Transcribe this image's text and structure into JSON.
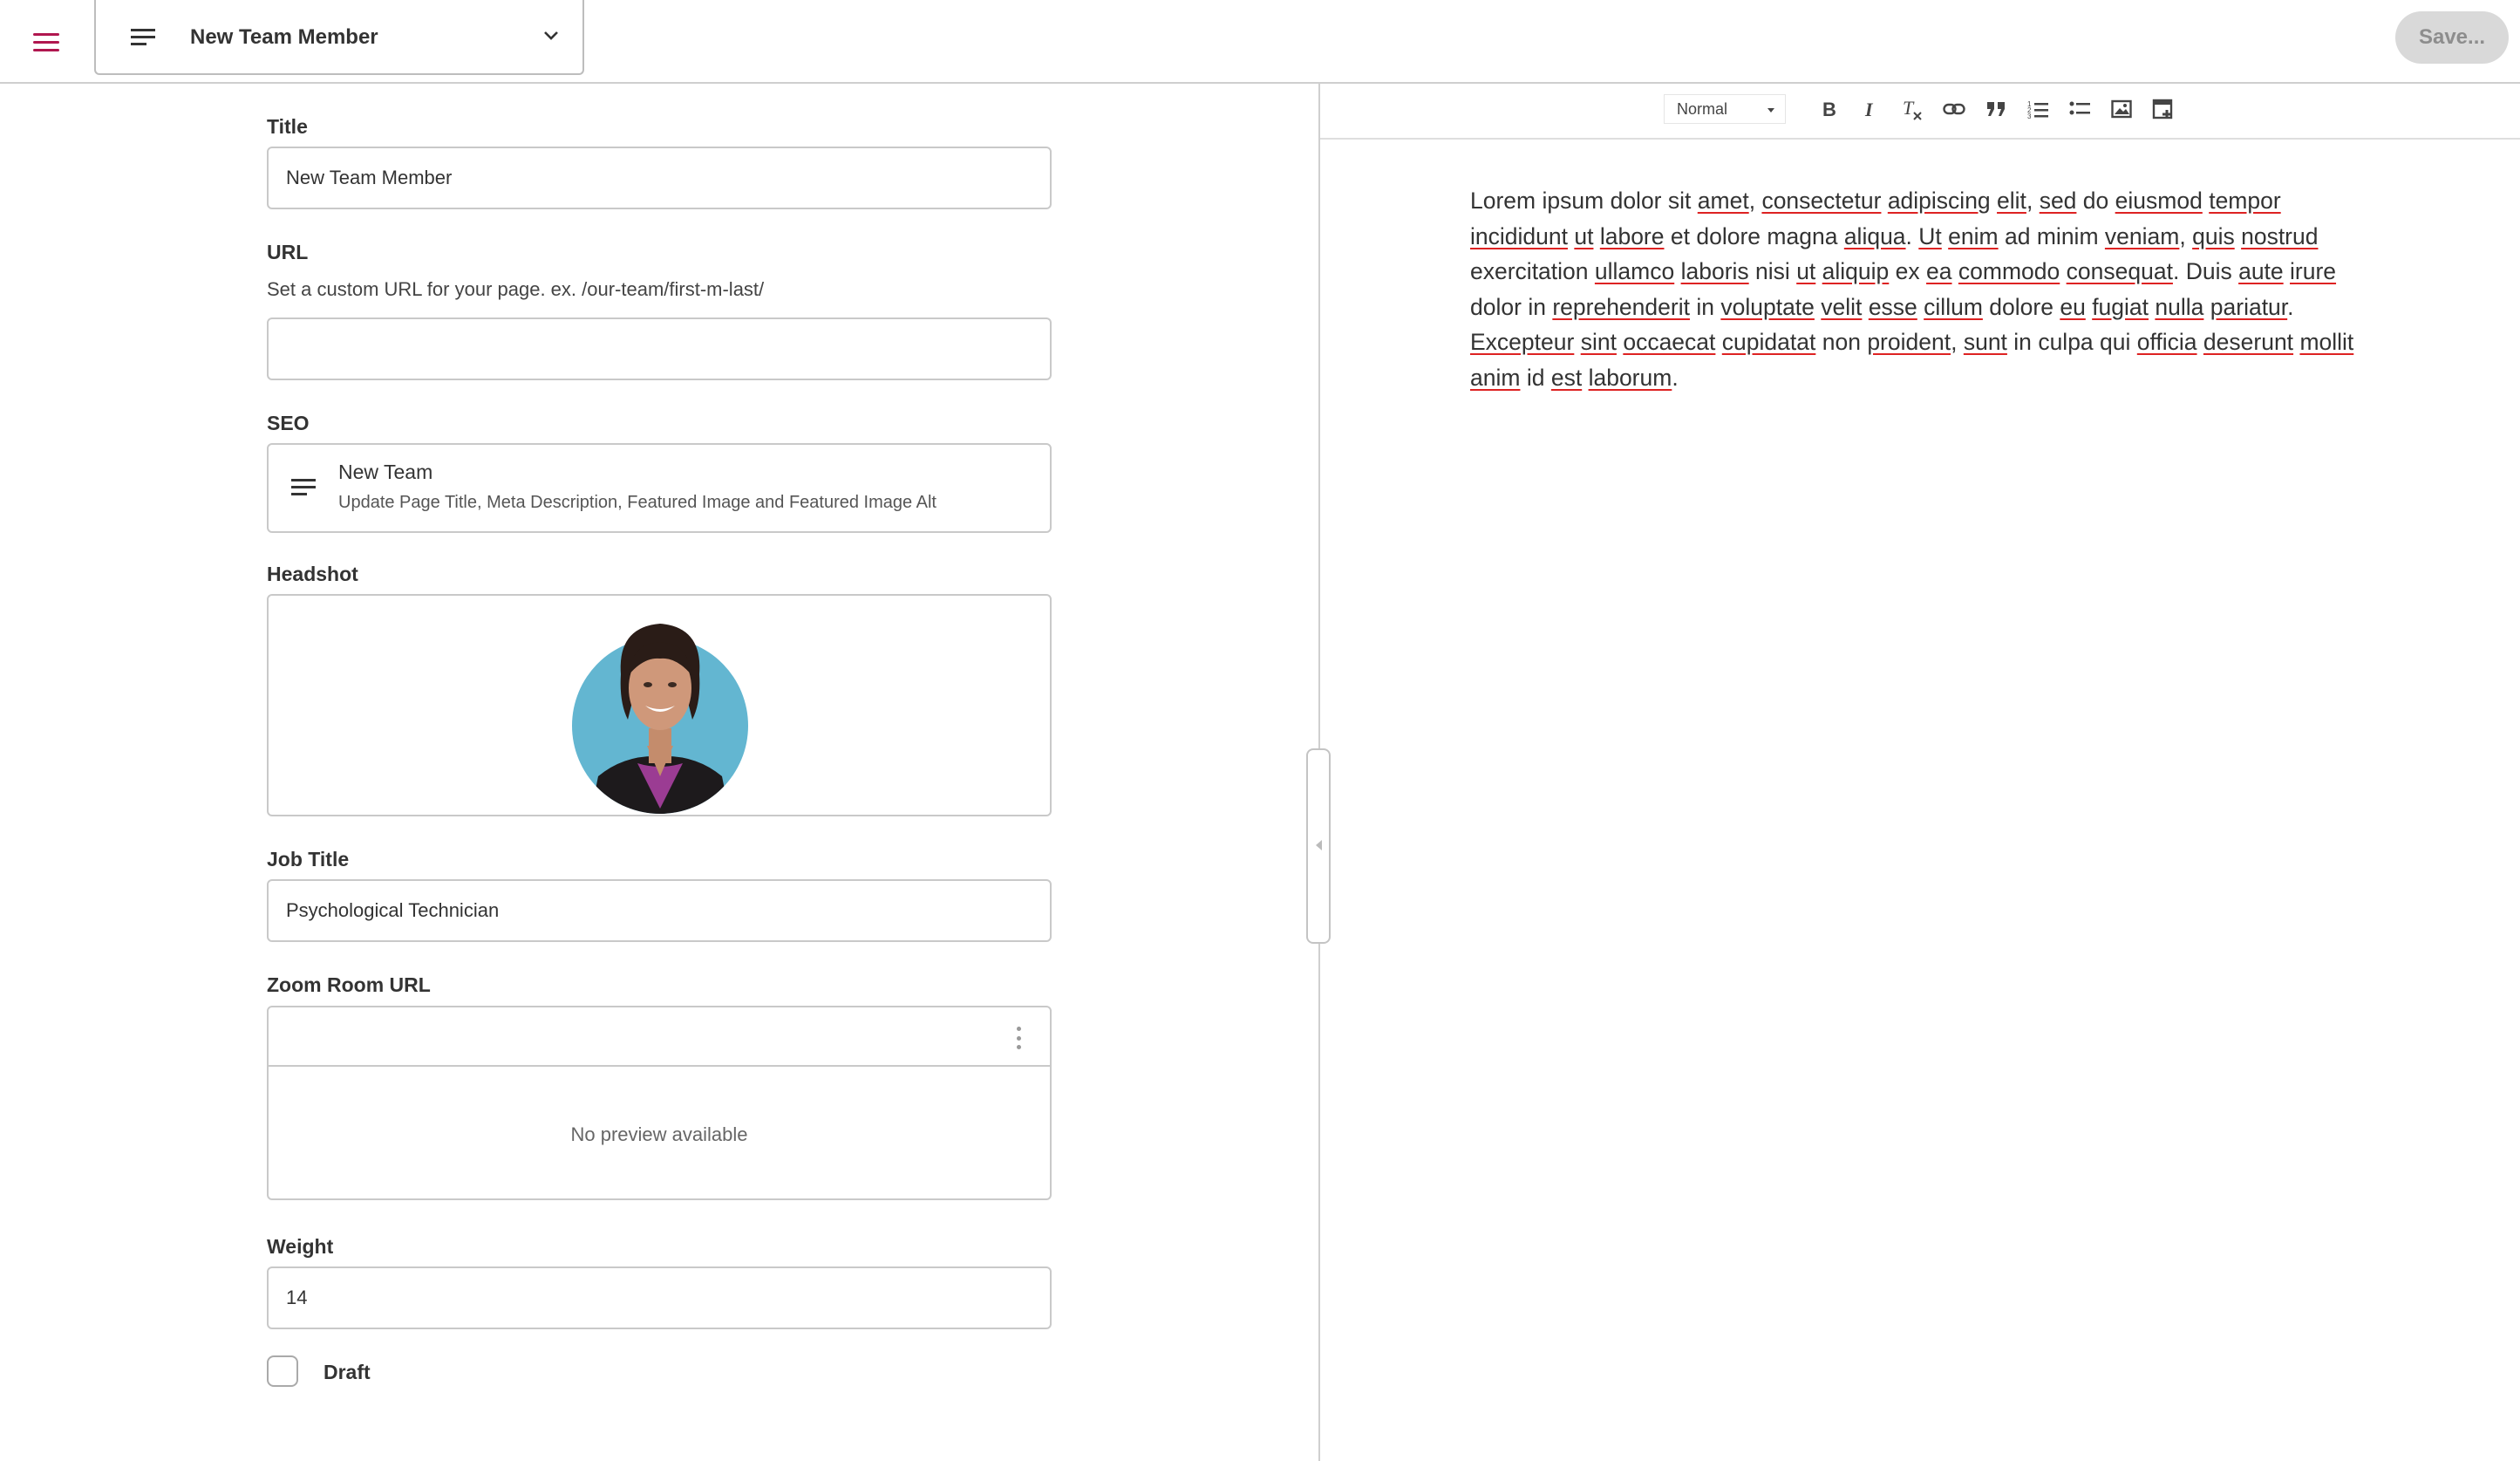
{
  "header": {
    "document_title": "New Team Member",
    "save_label": "Save...",
    "icons": {
      "menu": "hamburger-menu-icon",
      "document": "lines-icon",
      "dropdown": "chevron-down-icon"
    },
    "accent_color": "#b0174f"
  },
  "form": {
    "title": {
      "label": "Title",
      "value": "New Team Member"
    },
    "url": {
      "label": "URL",
      "help": "Set a custom URL for your page. ex. /our-team/first-m-last/",
      "value": ""
    },
    "seo": {
      "label": "SEO",
      "title": "New Team",
      "subtitle": "Update Page Title, Meta Description, Featured Image and Featured Image Alt"
    },
    "headshot": {
      "label": "Headshot",
      "image": "woman-portrait-avatar"
    },
    "job_title": {
      "label": "Job Title",
      "value": "Psychological Technician"
    },
    "zoom": {
      "label": "Zoom Room URL",
      "value": "",
      "no_preview": "No preview available"
    },
    "weight": {
      "label": "Weight",
      "value": "14"
    },
    "draft": {
      "label": "Draft",
      "checked": false
    }
  },
  "editor": {
    "format_select": "Normal",
    "toolbar_icons": [
      "bold-icon",
      "italic-icon",
      "clear-format-icon",
      "link-icon",
      "blockquote-icon",
      "ordered-list-icon",
      "bullet-list-icon",
      "image-icon",
      "embed-icon"
    ],
    "body": "Lorem ipsum dolor sit amet, consectetur adipiscing elit, sed do eiusmod tempor incididunt ut labore et dolore magna aliqua. Ut enim ad minim veniam, quis nostrud exercitation ullamco laboris nisi ut aliquip ex ea commodo consequat. Duis aute irure dolor in reprehenderit in voluptate velit esse cillum dolore eu fugiat nulla pariatur. Excepteur sint occaecat cupidatat non proident, sunt in culpa qui officia deserunt mollit anim id est laborum.",
    "misspelled_words": [
      "amet",
      "consectetur",
      "adipiscing",
      "elit",
      "sed",
      "eiusmod",
      "tempor",
      "incididunt",
      "ut",
      "labore",
      "aliqua",
      "Ut",
      "enim",
      "veniam",
      "quis",
      "nostrud",
      "ullamco",
      "laboris",
      "aliquip",
      "ea",
      "commodo",
      "consequat",
      "aute",
      "irure",
      "reprehenderit",
      "voluptate",
      "velit",
      "esse",
      "cillum",
      "eu",
      "fugiat",
      "nulla",
      "pariatur",
      "Excepteur",
      "sint",
      "occaecat",
      "cupidatat",
      "proident",
      "sunt",
      "officia",
      "deserunt",
      "mollit",
      "anim",
      "est",
      "laborum"
    ]
  }
}
